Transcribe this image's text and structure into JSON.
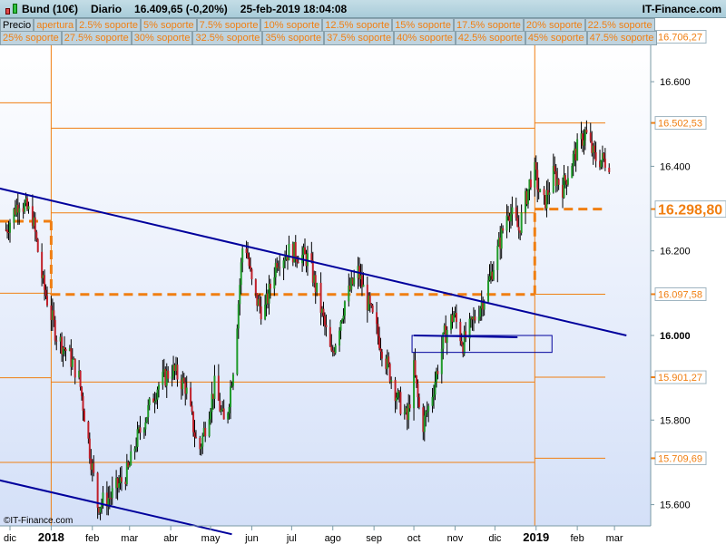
{
  "header": {
    "instrument": "Bund (10€)",
    "period": "Diario",
    "price": "16.409,65 (-0,20%)",
    "datetime": "25-feb-2019 18:04:08",
    "brand": "IT-Finance.com"
  },
  "legend_row1": [
    "Precio",
    "apertura",
    "2.5% soporte",
    "5% soporte",
    "7.5% soporte",
    "10% soporte",
    "12.5% soporte",
    "15% soporte",
    "17.5% soporte",
    "20% soporte",
    "22.5% soporte"
  ],
  "legend_row2": [
    "25% soporte",
    "27.5% soporte",
    "30% soporte",
    "32.5% soporte",
    "35% soporte",
    "37.5% soporte",
    "40% soporte",
    "42.5% soporte",
    "45% soporte",
    "47.5% soporte"
  ],
  "watermark": "©IT-Finance.com",
  "colors": {
    "levels": "#f07f12",
    "trend": "#00009c",
    "up": "#1f9a2a",
    "down": "#c0202a",
    "bg_top": "#ffffff",
    "bg_bottom": "#d4e0f8"
  },
  "chart_data": {
    "type": "candlestick",
    "y_ticks": [
      {
        "v": 16.6,
        "label": "16.600"
      },
      {
        "v": 16.4,
        "label": "16.400"
      },
      {
        "v": 16.2,
        "label": "16.200"
      },
      {
        "v": 16.0,
        "label": "16.000"
      },
      {
        "v": 15.8,
        "label": "15.800"
      },
      {
        "v": 15.6,
        "label": "15.600"
      }
    ],
    "level_labels": [
      {
        "v": 16.70627,
        "label": "16.706,27"
      },
      {
        "v": 16.50253,
        "label": "16.502,53"
      },
      {
        "v": 16.2988,
        "label": "16.298,80",
        "big": true
      },
      {
        "v": 16.09758,
        "label": "16.097,58"
      },
      {
        "v": 15.90127,
        "label": "15.901,27"
      },
      {
        "v": 15.70969,
        "label": "15.709,69"
      }
    ],
    "x_ticks": [
      {
        "d": "2017-12-01",
        "label": "dic"
      },
      {
        "d": "2018-01-01",
        "label": "2018",
        "bold": true
      },
      {
        "d": "2018-02-01",
        "label": "feb"
      },
      {
        "d": "2018-03-01",
        "label": "mar"
      },
      {
        "d": "2018-04-01",
        "label": "abr"
      },
      {
        "d": "2018-05-01",
        "label": "may"
      },
      {
        "d": "2018-06-01",
        "label": "jun"
      },
      {
        "d": "2018-07-01",
        "label": "jul"
      },
      {
        "d": "2018-08-01",
        "label": "ago"
      },
      {
        "d": "2018-09-01",
        "label": "sep"
      },
      {
        "d": "2018-10-01",
        "label": "oct"
      },
      {
        "d": "2018-11-01",
        "label": "nov"
      },
      {
        "d": "2018-12-01",
        "label": "dic"
      },
      {
        "d": "2019-01-01",
        "label": "2019",
        "bold": true
      },
      {
        "d": "2019-02-01",
        "label": "feb"
      },
      {
        "d": "2019-03-01",
        "label": "mar"
      }
    ],
    "ylim": [
      15.48,
      16.72
    ],
    "closes": [
      [
        "2017-11-28",
        16.25
      ],
      [
        "2017-12-08",
        16.32
      ],
      [
        "2017-12-18",
        16.28
      ],
      [
        "2017-12-26",
        16.12
      ],
      [
        "2018-01-05",
        16.0
      ],
      [
        "2018-01-15",
        15.95
      ],
      [
        "2018-01-22",
        15.9
      ],
      [
        "2018-01-29",
        15.75
      ],
      [
        "2018-02-05",
        15.6
      ],
      [
        "2018-02-15",
        15.62
      ],
      [
        "2018-02-28",
        15.68
      ],
      [
        "2018-03-06",
        15.75
      ],
      [
        "2018-03-22",
        15.88
      ],
      [
        "2018-04-02",
        15.92
      ],
      [
        "2018-04-12",
        15.88
      ],
      [
        "2018-04-22",
        15.72
      ],
      [
        "2018-05-04",
        15.88
      ],
      [
        "2018-05-12",
        15.78
      ],
      [
        "2018-05-19",
        15.95
      ],
      [
        "2018-05-26",
        16.25
      ],
      [
        "2018-06-02",
        16.1
      ],
      [
        "2018-06-10",
        16.05
      ],
      [
        "2018-06-20",
        16.18
      ],
      [
        "2018-06-30",
        16.2
      ],
      [
        "2018-07-14",
        16.18
      ],
      [
        "2018-07-24",
        16.05
      ],
      [
        "2018-07-31",
        15.95
      ],
      [
        "2018-08-10",
        16.08
      ],
      [
        "2018-08-20",
        16.15
      ],
      [
        "2018-08-30",
        16.05
      ],
      [
        "2018-09-09",
        15.95
      ],
      [
        "2018-09-19",
        15.85
      ],
      [
        "2018-09-26",
        15.8
      ],
      [
        "2018-10-01",
        15.92
      ],
      [
        "2018-10-07",
        15.78
      ],
      [
        "2018-10-14",
        15.85
      ],
      [
        "2018-10-24",
        16.0
      ],
      [
        "2018-10-31",
        16.05
      ],
      [
        "2018-11-07",
        15.98
      ],
      [
        "2018-11-17",
        16.05
      ],
      [
        "2018-11-24",
        16.1
      ],
      [
        "2018-12-03",
        16.2
      ],
      [
        "2018-12-11",
        16.3
      ],
      [
        "2018-12-19",
        16.25
      ],
      [
        "2018-12-30",
        16.4
      ],
      [
        "2019-01-06",
        16.3
      ],
      [
        "2019-01-14",
        16.38
      ],
      [
        "2019-01-21",
        16.35
      ],
      [
        "2019-01-29",
        16.42
      ],
      [
        "2019-02-07",
        16.48
      ],
      [
        "2019-02-14",
        16.42
      ],
      [
        "2019-02-25",
        16.41
      ]
    ],
    "levels": [
      {
        "from": "2017-11-20",
        "to": "2018-01-01",
        "v": [
          16.55,
          16.1,
          15.9,
          15.7
        ],
        "pivot": 16.27
      },
      {
        "from": "2018-01-01",
        "to": "2018-12-31",
        "v": [
          16.49,
          16.29,
          15.89,
          15.7
        ],
        "pivot": 16.097
      },
      {
        "from": "2018-12-31",
        "to": "2019-02-28",
        "v": [
          16.5025,
          16.0976,
          15.9013,
          15.7097
        ],
        "pivot": 16.2988
      }
    ],
    "trendlines": [
      {
        "d1": "2017-11-20",
        "v1": 16.35,
        "d2": "2019-03-10",
        "v2": 16.0
      },
      {
        "d1": "2017-11-20",
        "v1": 15.66,
        "d2": "2018-05-17",
        "v2": 15.53
      }
    ],
    "box": {
      "d1": "2018-10-01",
      "d2": "2018-12-18",
      "v1": 16.0,
      "v2": 15.96
    }
  }
}
